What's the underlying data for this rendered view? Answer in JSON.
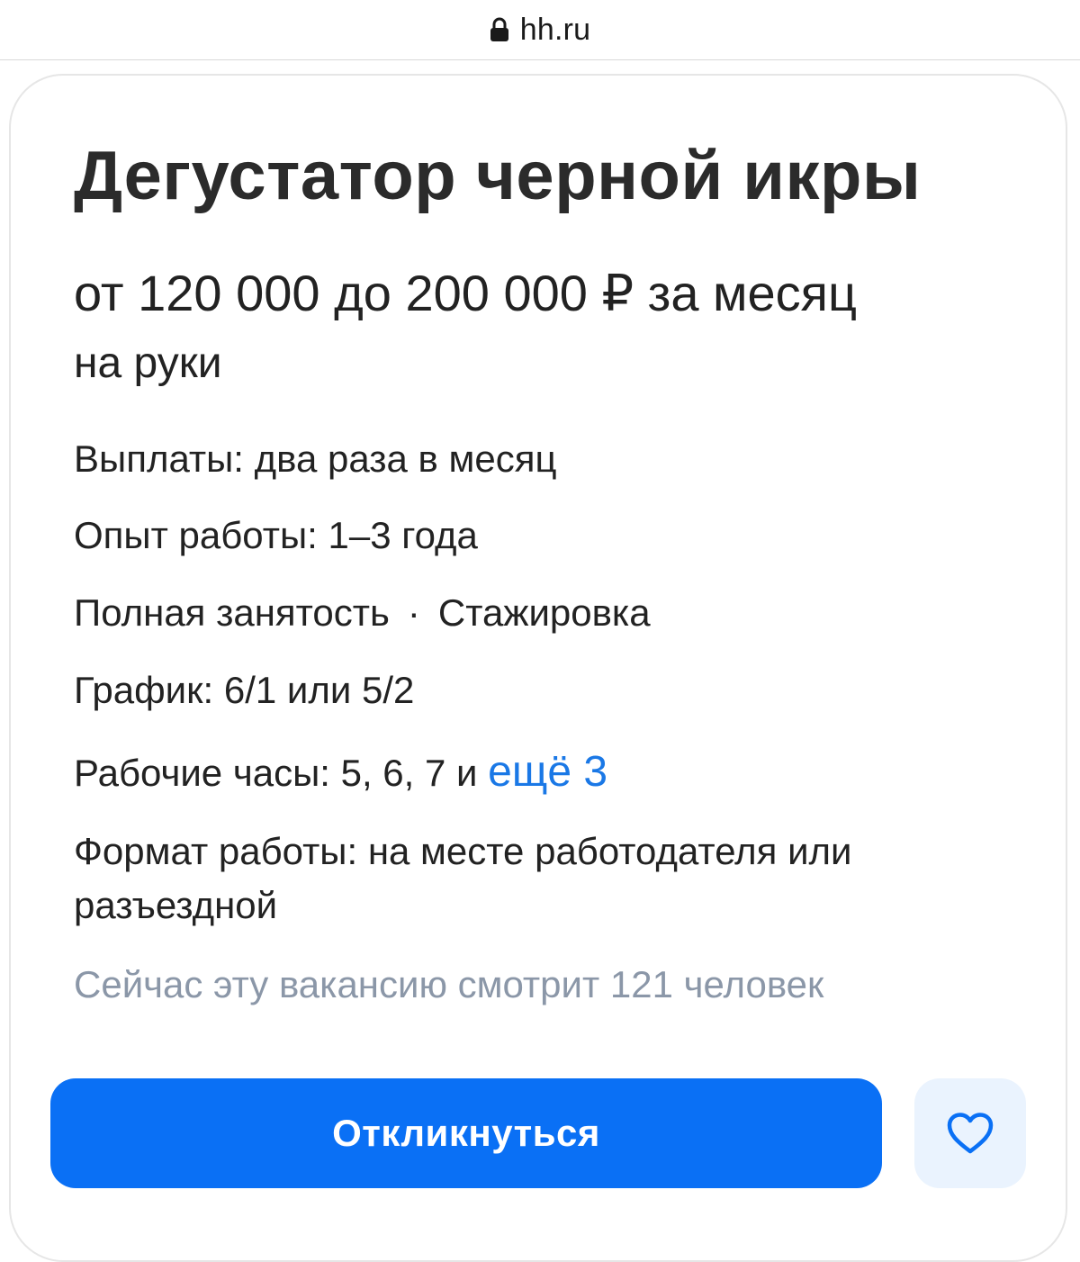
{
  "browser": {
    "url": "hh.ru",
    "lock_icon": "lock-icon"
  },
  "vacancy": {
    "title": "Дегустатор черной икры",
    "salary": "от 120 000 до 200 000 ₽ за месяц",
    "salary_note": "на руки",
    "payments": "Выплаты: два раза в месяц",
    "experience": "Опыт работы: 1–3 года",
    "employment": "Полная занятость",
    "internship": "Стажировка",
    "schedule": "График: 6/1 или 5/2",
    "hours_prefix": "Рабочие часы: 5, 6, 7 и",
    "hours_more": "ещё 3",
    "format_line1": "Формат работы: на месте работодателя или",
    "format_line2": "разъездной",
    "viewers": "Сейчас эту вакансию смотрит 121 человек"
  },
  "actions": {
    "apply_label": "Откликнуться",
    "favorite_icon": "heart-icon"
  },
  "colors": {
    "primary": "#0a70f5",
    "link": "#1a78e6",
    "muted": "#8b97a8",
    "favorite_bg": "#eaf3fe"
  }
}
